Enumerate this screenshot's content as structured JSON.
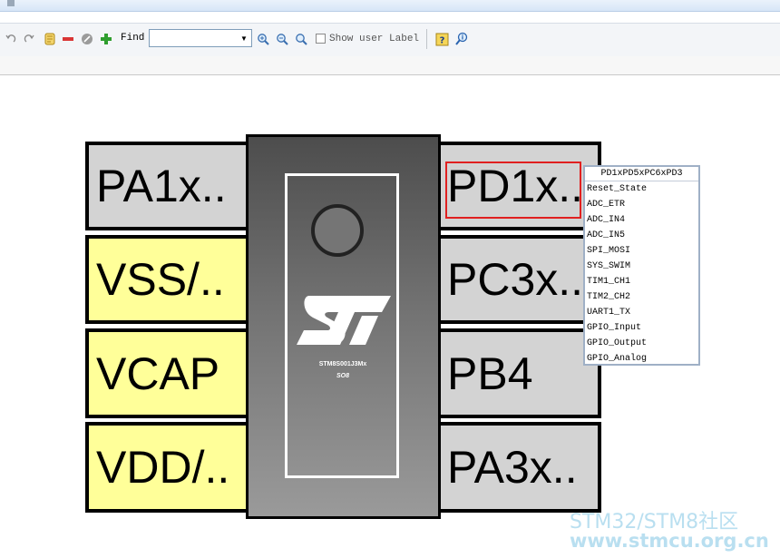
{
  "toolbar": {
    "find_label": "Find",
    "find_value": "",
    "find_placeholder": "",
    "show_user_label": "Show user Label",
    "show_user_label_checked": false,
    "icons": [
      "undo-icon",
      "redo-icon",
      "scroll-icon",
      "minus-icon",
      "reset-icon",
      "plus-icon",
      "zoom-in-icon",
      "zoom-out-icon",
      "zoom-fit-icon",
      "help-icon",
      "info-search-icon"
    ]
  },
  "chip": {
    "name": "STM8S001J3Mx",
    "package": "SO8"
  },
  "pins_left": [
    {
      "label": "PA1x..",
      "color": "gray"
    },
    {
      "label": "VSS/..",
      "color": "yellow"
    },
    {
      "label": "VCAP",
      "color": "yellow"
    },
    {
      "label": "VDD/..",
      "color": "yellow"
    }
  ],
  "pins_right": [
    {
      "label": "PD1x..",
      "color": "gray"
    },
    {
      "label": "PC3x..",
      "color": "gray"
    },
    {
      "label": "PB4",
      "color": "gray"
    },
    {
      "label": "PA3x..",
      "color": "gray"
    }
  ],
  "popup": {
    "title": "PD1xPD5xPC6xPD3",
    "items": [
      "Reset_State",
      "ADC_ETR",
      "ADC_IN4",
      "ADC_IN5",
      "SPI_MOSI",
      "SYS_SWIM",
      "TIM1_CH1",
      "TIM2_CH2",
      "UART1_TX",
      "GPIO_Input",
      "GPIO_Output",
      "GPIO_Analog"
    ],
    "highlighted": [
      "SYS_SWIM",
      "TIM2_CH2"
    ]
  },
  "watermark": {
    "line1": "STM32/STM8社区",
    "line2": "www.stmcu.org.cn"
  },
  "colors": {
    "pin_gray": "#d3d3d3",
    "pin_yellow": "#ffff99",
    "highlight_red": "#e02020",
    "watermark": "#b9dff0"
  }
}
